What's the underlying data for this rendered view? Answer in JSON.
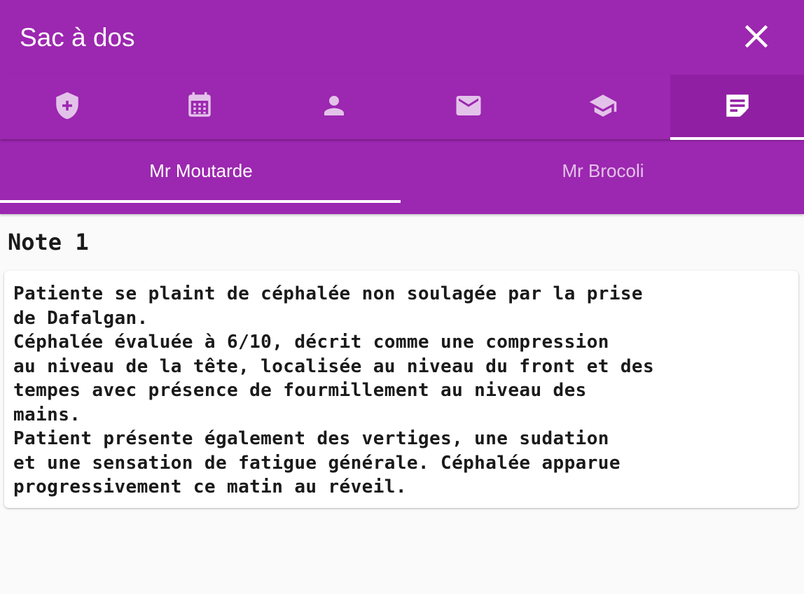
{
  "header": {
    "title": "Sac à dos",
    "close_icon": "close-icon",
    "background_color": "#9c27b0"
  },
  "icon_tabs": [
    {
      "icon": "shield-plus-icon",
      "active": false
    },
    {
      "icon": "calendar-icon",
      "active": false
    },
    {
      "icon": "person-icon",
      "active": false
    },
    {
      "icon": "mail-icon",
      "active": false
    },
    {
      "icon": "school-icon",
      "active": false
    },
    {
      "icon": "note-edit-icon",
      "active": true
    }
  ],
  "name_tabs": [
    {
      "label": "Mr Moutarde",
      "active": true
    },
    {
      "label": "Mr Brocoli",
      "active": false
    }
  ],
  "note": {
    "title": "Note 1",
    "lines": [
      "Patiente se plaint de céphalée non soulagée par la prise",
      "de Dafalgan.",
      "Céphalée évaluée à 6/10, décrit comme une compression",
      "au niveau de la tête, localisée au niveau du front et des",
      "tempes avec présence de fourmillement au niveau des",
      "mains.",
      "Patient présente également des vertiges, une sudation",
      "et une sensation de fatigue générale. Céphalée apparue",
      "progressivement ce matin au réveil."
    ]
  }
}
